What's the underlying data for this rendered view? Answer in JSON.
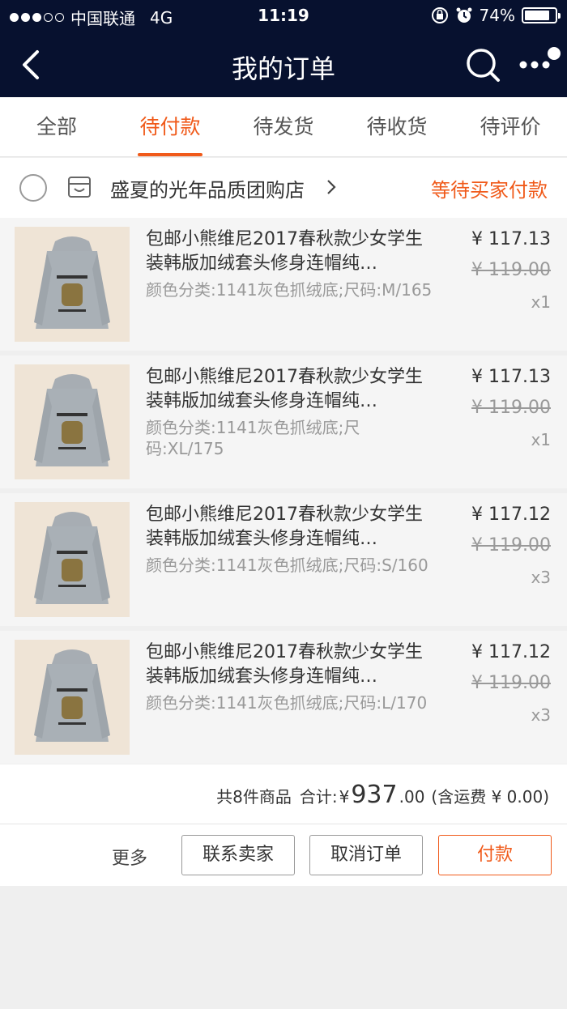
{
  "status_bar": {
    "carrier": "中国联通",
    "network": "4G",
    "time": "11:19",
    "battery": "74%"
  },
  "nav": {
    "title": "我的订单"
  },
  "tabs": [
    {
      "label": "全部"
    },
    {
      "label": "待付款",
      "active": true
    },
    {
      "label": "待发货"
    },
    {
      "label": "待收货"
    },
    {
      "label": "待评价"
    }
  ],
  "shop": {
    "name": "盛夏的光年品质团购店",
    "status": "等待买家付款"
  },
  "items": [
    {
      "title": "包邮小熊维尼2017春秋款少女学生装韩版加绒套头修身连帽纯…",
      "spec": "颜色分类:1141灰色抓绒底;尺码:M/165",
      "price": "¥ 117.13",
      "old_price": "¥ 119.00",
      "qty": "x1"
    },
    {
      "title": "包邮小熊维尼2017春秋款少女学生装韩版加绒套头修身连帽纯…",
      "spec": "颜色分类:1141灰色抓绒底;尺码:XL/175",
      "price": "¥ 117.13",
      "old_price": "¥ 119.00",
      "qty": "x1"
    },
    {
      "title": "包邮小熊维尼2017春秋款少女学生装韩版加绒套头修身连帽纯…",
      "spec": "颜色分类:1141灰色抓绒底;尺码:S/160",
      "price": "¥ 117.12",
      "old_price": "¥ 119.00",
      "qty": "x3"
    },
    {
      "title": "包邮小熊维尼2017春秋款少女学生装韩版加绒套头修身连帽纯…",
      "spec": "颜色分类:1141灰色抓绒底;尺码:L/170",
      "price": "¥ 117.12",
      "old_price": "¥ 119.00",
      "qty": "x3"
    }
  ],
  "summary": {
    "count": "共8件商品",
    "total_label": "合计:",
    "currency": "¥",
    "total_int": "937",
    "total_dec": ".00",
    "shipping": "(含运费 ¥ 0.00)"
  },
  "actions": {
    "more": "更多",
    "contact": "联系卖家",
    "cancel": "取消订单",
    "pay": "付款"
  },
  "colors": {
    "accent": "#f05a1a",
    "nav_bg": "#07112f"
  }
}
